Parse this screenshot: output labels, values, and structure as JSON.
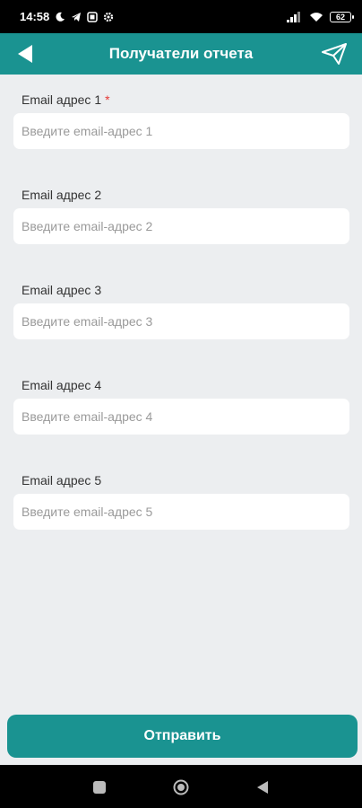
{
  "status_bar": {
    "time": "14:58",
    "battery": "62"
  },
  "app_bar": {
    "title": "Получатели отчета",
    "back_icon": "back-arrow-icon",
    "send_icon": "paper-plane-icon"
  },
  "form": {
    "required_mark": "*",
    "fields": [
      {
        "label": "Email адрес 1",
        "placeholder": "Введите email-адрес 1",
        "value": "",
        "required": true
      },
      {
        "label": "Email адрес 2",
        "placeholder": "Введите email-адрес 2",
        "value": "",
        "required": false
      },
      {
        "label": "Email адрес 3",
        "placeholder": "Введите email-адрес 3",
        "value": "",
        "required": false
      },
      {
        "label": "Email адрес 4",
        "placeholder": "Введите email-адрес 4",
        "value": "",
        "required": false
      },
      {
        "label": "Email адрес 5",
        "placeholder": "Введите email-адрес 5",
        "value": "",
        "required": false
      }
    ]
  },
  "submit": {
    "label": "Отправить"
  },
  "colors": {
    "accent": "#1a9391",
    "background": "#eceef0",
    "required": "#e53935"
  },
  "nav_bar": {
    "icons": [
      "recents-square-icon",
      "home-circle-icon",
      "back-triangle-icon"
    ]
  }
}
